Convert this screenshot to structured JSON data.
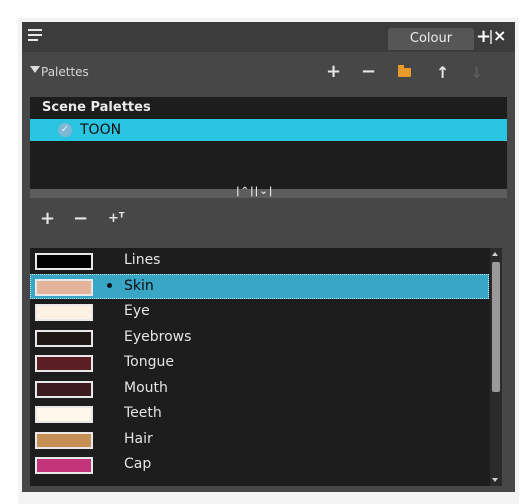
{
  "window": {
    "tab_label": "Colour"
  },
  "palettes": {
    "title": "Palettes"
  },
  "scene_palettes": {
    "header": "Scene Palettes",
    "items": [
      {
        "label": "TOON",
        "checked": true,
        "selected": true
      }
    ]
  },
  "splitter_glyph": "^||v",
  "colors": [
    {
      "label": "Lines",
      "swatch": "#000000",
      "selected": false
    },
    {
      "label": "Skin",
      "swatch": "#e3b49a",
      "selected": true
    },
    {
      "label": "Eye",
      "swatch": "#fdf1e3",
      "selected": false
    },
    {
      "label": "Eyebrows",
      "swatch": "#1f1814",
      "selected": false
    },
    {
      "label": "Tongue",
      "swatch": "#5b1f23",
      "selected": false
    },
    {
      "label": "Mouth",
      "swatch": "#3b1a20",
      "selected": false
    },
    {
      "label": "Teeth",
      "swatch": "#fff6ec",
      "selected": false
    },
    {
      "label": "Hair",
      "swatch": "#c58f55",
      "selected": false
    },
    {
      "label": "Cap",
      "swatch": "#c23377",
      "selected": false
    }
  ],
  "accent_color": "#28c4e0"
}
